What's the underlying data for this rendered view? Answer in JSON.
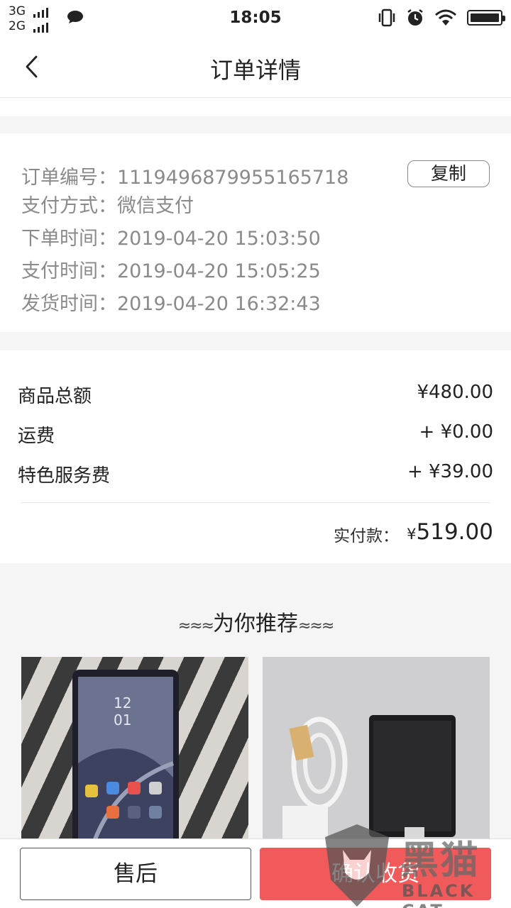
{
  "status_bar": {
    "network_1": "3G",
    "network_2": "2G",
    "time": "18:05"
  },
  "header": {
    "title": "订单详情"
  },
  "order": {
    "number_label": "订单编号：",
    "number_value": "1119496879955165718",
    "copy_label": "复制",
    "payment_label": "支付方式：",
    "payment_value": "微信支付",
    "order_time_label": "下单时间：",
    "order_time_value": "2019-04-20 15:03:50",
    "pay_time_label": "支付时间：",
    "pay_time_value": "2019-04-20 15:05:25",
    "ship_time_label": "发货时间：",
    "ship_time_value": "2019-04-20 16:32:43"
  },
  "amounts": {
    "subtotal_label": "商品总额",
    "subtotal_value": "¥480.00",
    "shipping_label": "运费",
    "shipping_value": "+ ¥0.00",
    "service_label": "特色服务费",
    "service_value": "+ ¥39.00",
    "paid_label": "实付款：",
    "paid_currency": "¥",
    "paid_value": "519.00"
  },
  "recommend": {
    "title": "为你推荐",
    "left_deco": "≈≈≈",
    "right_deco": "≈≈≈"
  },
  "bottom": {
    "after_sale_label": "售后",
    "confirm_label": "确认收货"
  },
  "watermark": {
    "cn": "黑猫",
    "en": "BLACK CAT"
  },
  "colors": {
    "accent": "#f05a5a",
    "muted_text": "#8a8a8a"
  }
}
